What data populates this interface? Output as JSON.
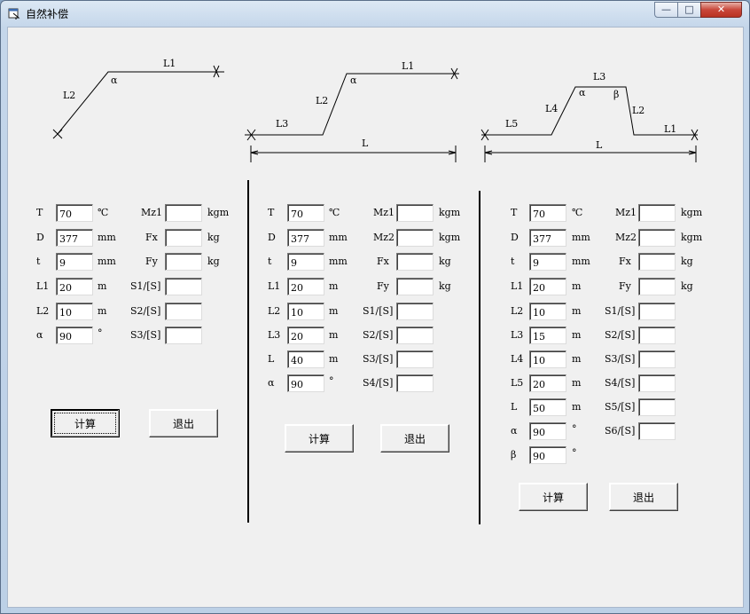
{
  "window": {
    "title": "自然补偿",
    "min_glyph": "—",
    "max_glyph": "□",
    "close_glyph": "✕"
  },
  "diagrams": {
    "d1": {
      "L1": "L1",
      "L2": "L2",
      "alpha": "α"
    },
    "d2": {
      "L1": "L1",
      "L2": "L2",
      "L3": "L3",
      "L": "L",
      "alpha": "α"
    },
    "d3": {
      "L1": "L1",
      "L2": "L2",
      "L3": "L3",
      "L4": "L4",
      "L5": "L5",
      "L": "L",
      "alpha": "α",
      "beta": "β"
    }
  },
  "panel1": {
    "inputs": [
      {
        "label": "T",
        "value": "70",
        "unit": "℃"
      },
      {
        "label": "D",
        "value": "377",
        "unit": "mm"
      },
      {
        "label": "t",
        "value": "9",
        "unit": "mm"
      },
      {
        "label": "L1",
        "value": "20",
        "unit": "m"
      },
      {
        "label": "L2",
        "value": "10",
        "unit": "m"
      },
      {
        "label": "α",
        "value": "90",
        "unit": "°"
      }
    ],
    "outputs": [
      {
        "label": "Mz1",
        "value": "",
        "unit": "kgm"
      },
      {
        "label": "Fx",
        "value": "",
        "unit": "kg"
      },
      {
        "label": "Fy",
        "value": "",
        "unit": "kg"
      },
      {
        "label": "S1/[S]",
        "value": "",
        "unit": ""
      },
      {
        "label": "S2/[S]",
        "value": "",
        "unit": ""
      },
      {
        "label": "S3/[S]",
        "value": "",
        "unit": ""
      }
    ],
    "calc_label": "计算",
    "exit_label": "退出"
  },
  "panel2": {
    "inputs": [
      {
        "label": "T",
        "value": "70",
        "unit": "℃"
      },
      {
        "label": "D",
        "value": "377",
        "unit": "mm"
      },
      {
        "label": "t",
        "value": "9",
        "unit": "mm"
      },
      {
        "label": "L1",
        "value": "20",
        "unit": "m"
      },
      {
        "label": "L2",
        "value": "10",
        "unit": "m"
      },
      {
        "label": "L3",
        "value": "20",
        "unit": "m"
      },
      {
        "label": "L",
        "value": "40",
        "unit": "m"
      },
      {
        "label": "α",
        "value": "90",
        "unit": "°"
      }
    ],
    "outputs": [
      {
        "label": "Mz1",
        "value": "",
        "unit": "kgm"
      },
      {
        "label": "Mz2",
        "value": "",
        "unit": "kgm"
      },
      {
        "label": "Fx",
        "value": "",
        "unit": "kg"
      },
      {
        "label": "Fy",
        "value": "",
        "unit": "kg"
      },
      {
        "label": "S1/[S]",
        "value": "",
        "unit": ""
      },
      {
        "label": "S2/[S]",
        "value": "",
        "unit": ""
      },
      {
        "label": "S3/[S]",
        "value": "",
        "unit": ""
      },
      {
        "label": "S4/[S]",
        "value": "",
        "unit": ""
      }
    ],
    "calc_label": "计算",
    "exit_label": "退出"
  },
  "panel3": {
    "inputs": [
      {
        "label": "T",
        "value": "70",
        "unit": "℃"
      },
      {
        "label": "D",
        "value": "377",
        "unit": "mm"
      },
      {
        "label": "t",
        "value": "9",
        "unit": "mm"
      },
      {
        "label": "L1",
        "value": "20",
        "unit": "m"
      },
      {
        "label": "L2",
        "value": "10",
        "unit": "m"
      },
      {
        "label": "L3",
        "value": "15",
        "unit": "m"
      },
      {
        "label": "L4",
        "value": "10",
        "unit": "m"
      },
      {
        "label": "L5",
        "value": "20",
        "unit": "m"
      },
      {
        "label": "L",
        "value": "50",
        "unit": "m"
      },
      {
        "label": "α",
        "value": "90",
        "unit": "°"
      },
      {
        "label": "β",
        "value": "90",
        "unit": "°"
      }
    ],
    "outputs": [
      {
        "label": "Mz1",
        "value": "",
        "unit": "kgm"
      },
      {
        "label": "Mz2",
        "value": "",
        "unit": "kgm"
      },
      {
        "label": "Fx",
        "value": "",
        "unit": "kg"
      },
      {
        "label": "Fy",
        "value": "",
        "unit": "kg"
      },
      {
        "label": "S1/[S]",
        "value": "",
        "unit": ""
      },
      {
        "label": "S2/[S]",
        "value": "",
        "unit": ""
      },
      {
        "label": "S3/[S]",
        "value": "",
        "unit": ""
      },
      {
        "label": "S4/[S]",
        "value": "",
        "unit": ""
      },
      {
        "label": "S5/[S]",
        "value": "",
        "unit": ""
      },
      {
        "label": "S6/[S]",
        "value": "",
        "unit": ""
      }
    ],
    "calc_label": "计算",
    "exit_label": "退出"
  }
}
